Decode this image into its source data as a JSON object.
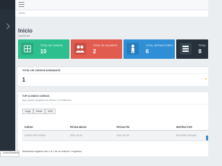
{
  "breadcrumb": "Inicio",
  "page": {
    "title": "Inicio",
    "subtitle": "Dashboard"
  },
  "cards": [
    {
      "label": "TOTAL DE CURSOS",
      "value": "10",
      "color": "#2ebf8f",
      "icon": "course-icon"
    },
    {
      "label": "TOTAL DE USUARIOS",
      "value": "2",
      "color": "#e15b4f",
      "icon": "users-icon"
    },
    {
      "label": "TOTAL INSTRUCTORES",
      "value": "6",
      "color": "#2e8ed6",
      "icon": "instructor-icon"
    },
    {
      "label": "TOTAL",
      "value": "8",
      "color": "#27313b",
      "icon": "stack-icon"
    }
  ],
  "assigned": {
    "title": "TOTAL DE CURSOS ASIGNADOS",
    "value": "1"
  },
  "recent": {
    "title": "TOP ULTIMOS CURSOS",
    "subtitle": "Aquí podrás visualizar los últimos 10 certificados",
    "buttons": [
      "Copy",
      "Excel",
      "CSV"
    ],
    "columns": [
      "CURSO",
      "FECHA INICIO",
      "FECHA FIN",
      "INSTRUCTOR"
    ],
    "rows": [
      [
        "CURSO DE HTML5",
        "2021-04-01",
        "2021-04-05",
        "RICARDO PALMA"
      ]
    ],
    "footer": "Mostrando registros del 1 al 1 de un total de 1 registros"
  },
  "tooltip": "…/Inicio/Dashboard"
}
